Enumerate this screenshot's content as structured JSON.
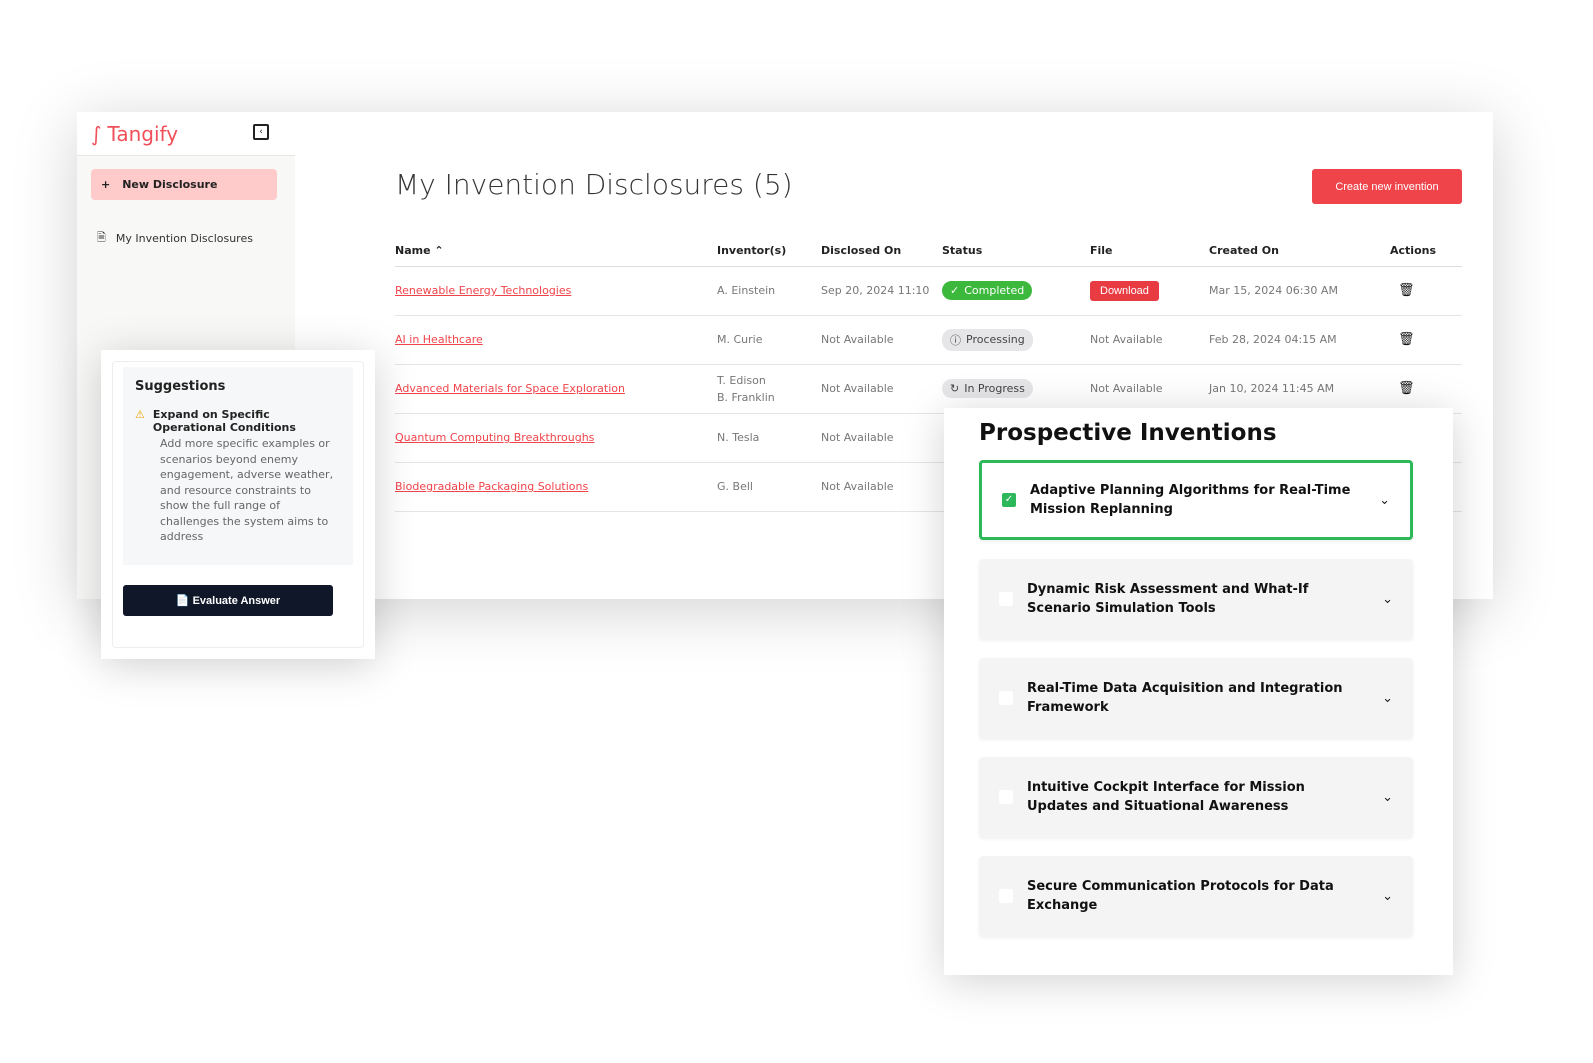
{
  "brand": "Tangify",
  "sidebar": {
    "new_label": "New Disclosure",
    "items": [
      {
        "label": "My Invention Disclosures"
      }
    ]
  },
  "main": {
    "title": "My Invention Disclosures (5)",
    "create_label": "Create new invention",
    "columns": [
      "Name",
      "Inventor(s)",
      "Disclosed On",
      "Status",
      "File",
      "Created On",
      "Actions"
    ],
    "rows": [
      {
        "name": "Renewable Energy Technologies",
        "inventors": "A. Einstein",
        "disclosed": "Sep 20, 2024 11:10",
        "status": "Completed",
        "file": "Download",
        "created": "Mar 15, 2024 06:30 AM"
      },
      {
        "name": "AI in Healthcare",
        "inventors": "M. Curie",
        "disclosed": "Not Available",
        "status": "Processing",
        "file": "Not Available",
        "created": "Feb 28, 2024 04:15 AM"
      },
      {
        "name": "Advanced Materials for Space Exploration",
        "inventors": "T. Edison\nB. Franklin",
        "disclosed": "Not Available",
        "status": "In Progress",
        "file": "Not Available",
        "created": "Jan 10, 2024 11:45 AM"
      },
      {
        "name": "Quantum Computing Breakthroughs",
        "inventors": "N. Tesla",
        "disclosed": "Not Available"
      },
      {
        "name": "Biodegradable Packaging Solutions",
        "inventors": "G. Bell",
        "disclosed": "Not Available"
      }
    ]
  },
  "suggestions": {
    "title": "Suggestions",
    "item_title": "Expand on Specific Operational Conditions",
    "item_text": "Add more specific examples or scenarios beyond enemy engagement, adverse weather, and resource constraints to show the full range of challenges the system aims to address",
    "button": "Evaluate Answer"
  },
  "prospective": {
    "title": "Prospective Inventions",
    "items": [
      {
        "label": "Adaptive Planning Algorithms for Real-Time Mission Replanning",
        "checked": true
      },
      {
        "label": "Dynamic Risk Assessment and What-If Scenario Simulation Tools",
        "checked": false
      },
      {
        "label": "Real-Time Data Acquisition and Integration Framework",
        "checked": false
      },
      {
        "label": "Intuitive Cockpit Interface for Mission Updates and Situational Awareness",
        "checked": false
      },
      {
        "label": "Secure Communication Protocols for Data Exchange",
        "checked": false
      }
    ]
  },
  "colors": {
    "accent": "#f0444b",
    "success": "#3cb83c",
    "selected": "#2eb85c",
    "dark": "#0f1729"
  }
}
